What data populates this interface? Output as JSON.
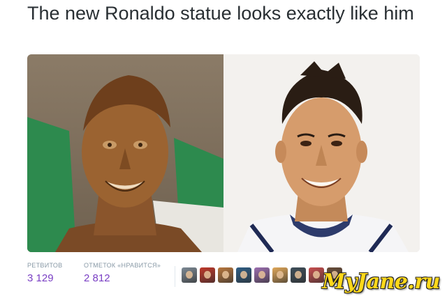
{
  "tweet": {
    "text": "The new Ronaldo statue looks exactly like him"
  },
  "media": {
    "left_image_alt": "bronze bust statue",
    "right_image_alt": "smiling man photo"
  },
  "stats": {
    "retweets_label": "РЕТВИТОВ",
    "retweets_value": "3 129",
    "likes_label": "ОТМЕТОК «НРАВИТСЯ»",
    "likes_value": "2 812"
  },
  "avatars": [
    {
      "color": "#7d8a95"
    },
    {
      "color": "#c0392b"
    },
    {
      "color": "#b9783f"
    },
    {
      "color": "#2f5e85"
    },
    {
      "color": "#9c6fb0"
    },
    {
      "color": "#e0a85a"
    },
    {
      "color": "#3f4f5a"
    },
    {
      "color": "#c94f4f"
    },
    {
      "color": "#6a4e3a"
    }
  ],
  "watermark": {
    "text": "MyJane.ru"
  },
  "colors": {
    "stat_value": "#7a3fc4",
    "stat_label": "#8899a6",
    "text": "#292f33",
    "watermark": "#ffd81a"
  }
}
